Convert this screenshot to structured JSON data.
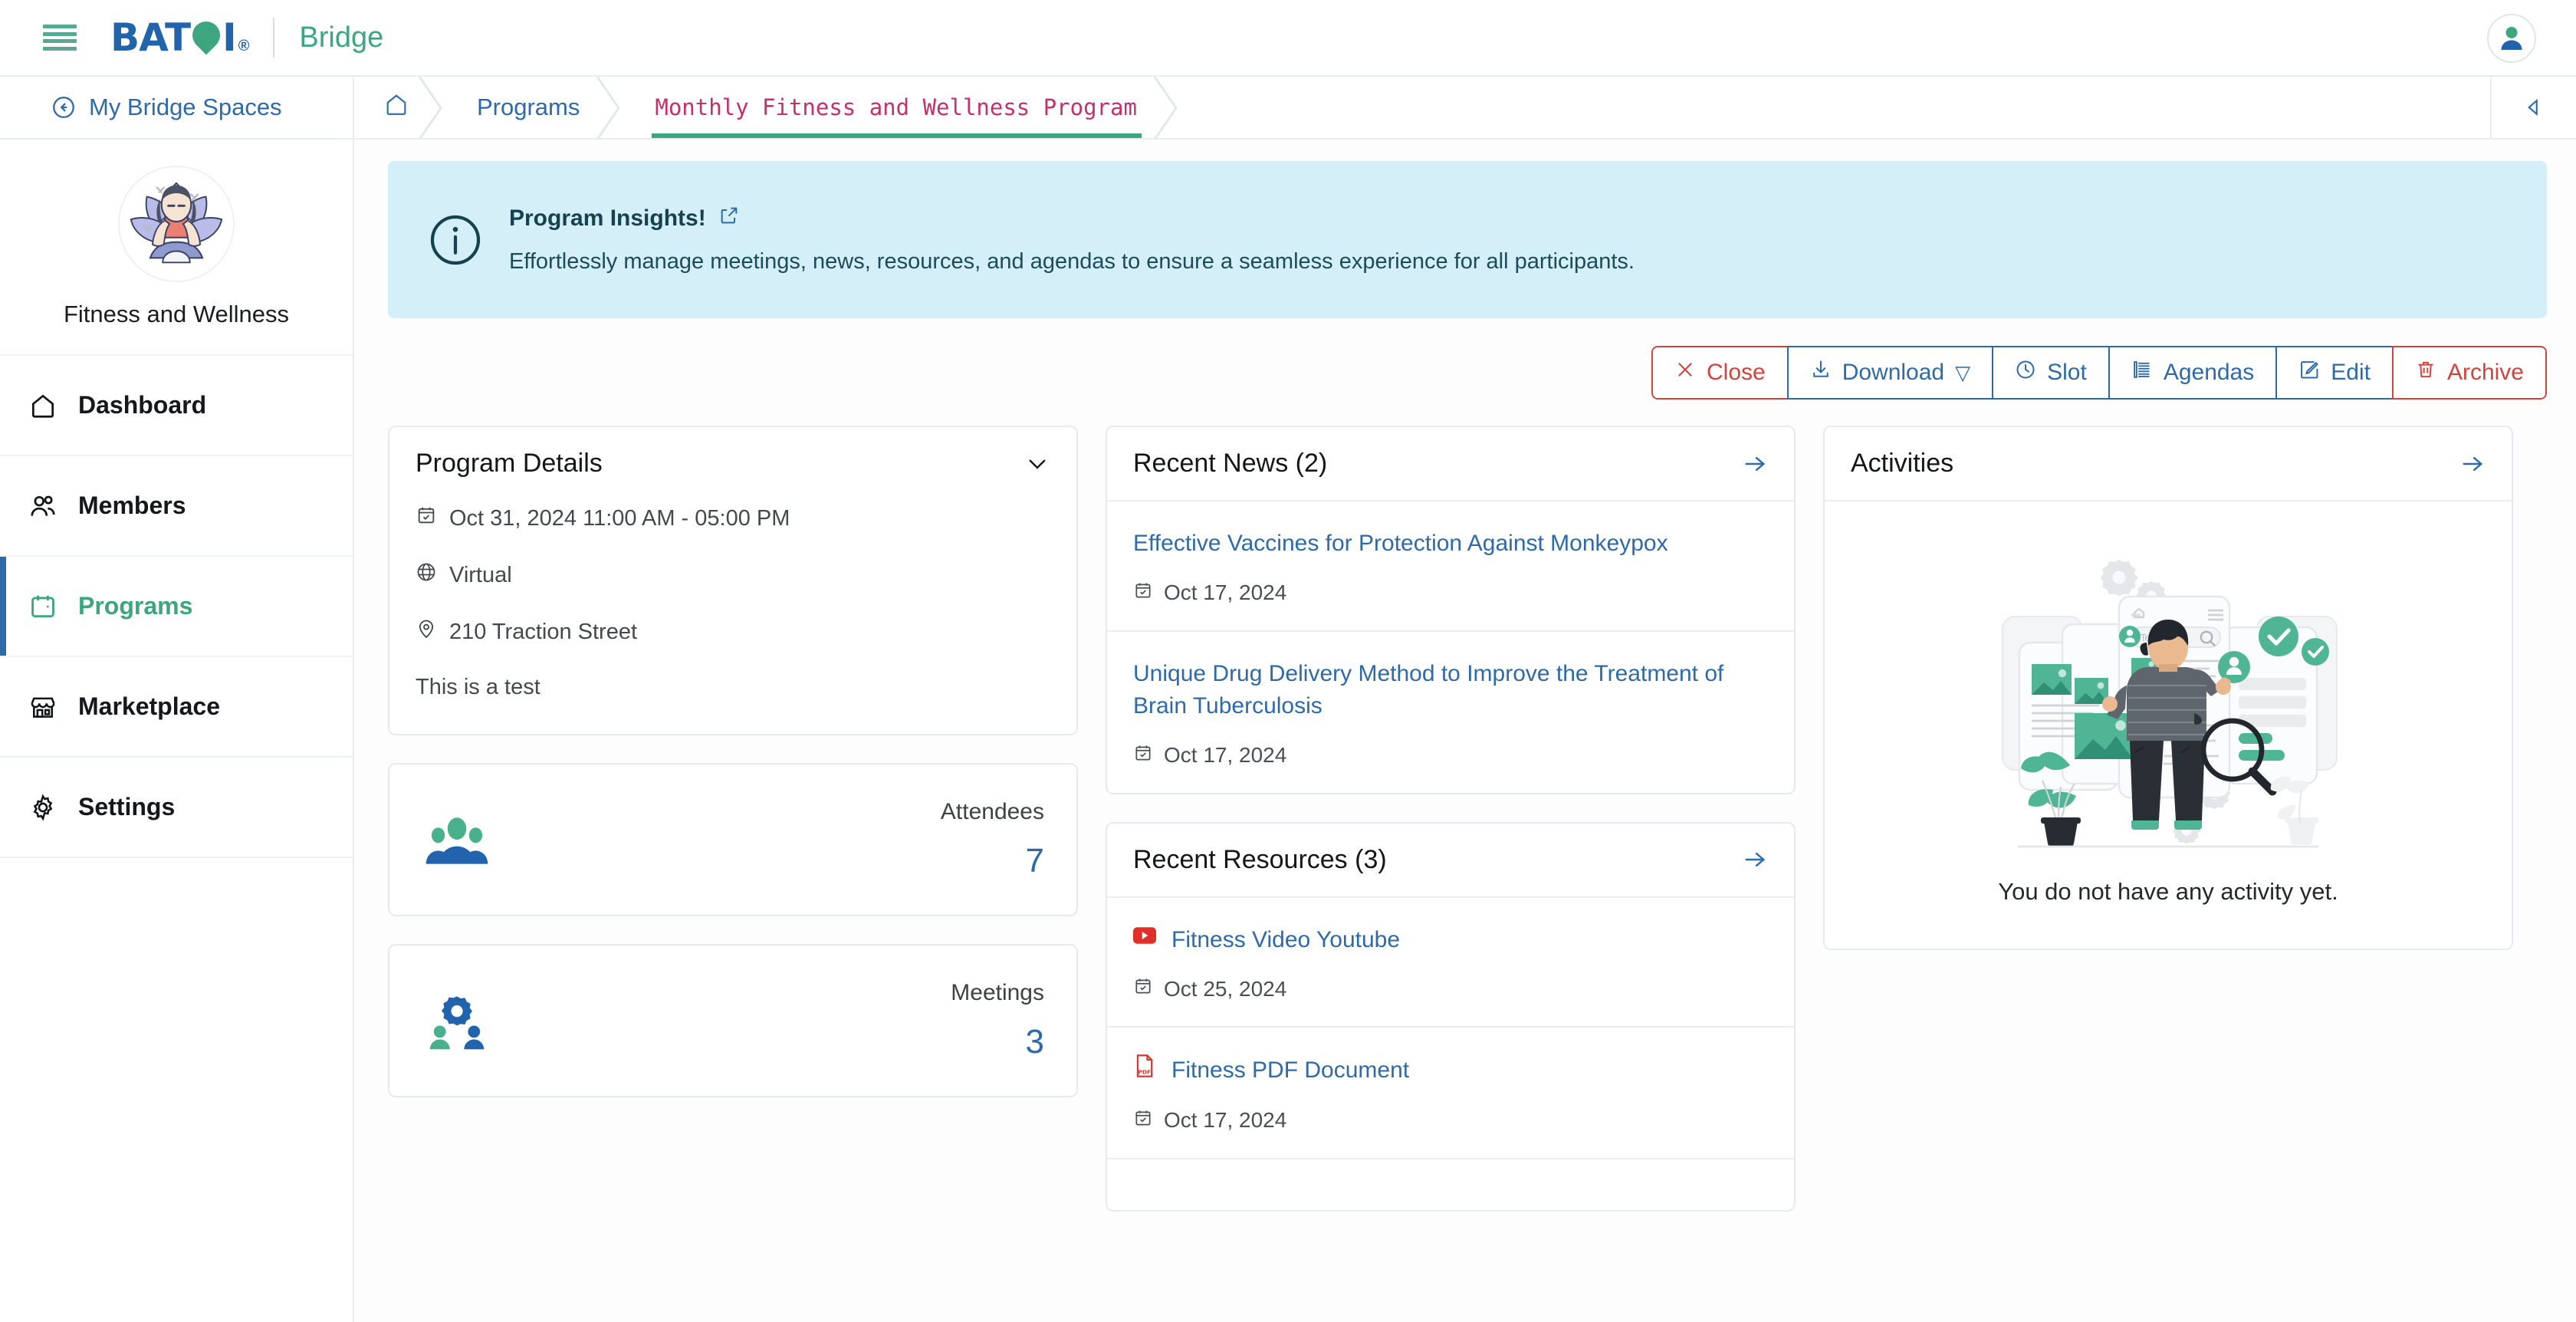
{
  "header": {
    "menu_icon": "hamburger-icon",
    "brand": "BATOI",
    "brand_registered": "®",
    "brand_sub": "Bridge",
    "user_icon": "user-avatar-icon"
  },
  "breadcrumb": {
    "back_label": "My Bridge Spaces",
    "back_icon": "circle-back-arrow-icon",
    "home_icon": "home-icon",
    "items": [
      {
        "label": "Programs",
        "active": false
      },
      {
        "label": "Monthly Fitness and Wellness Program",
        "active": true
      }
    ],
    "collapse_icon": "collapse-left-icon"
  },
  "sidebar": {
    "space_name": "Fitness and Wellness",
    "space_avatar_icon": "yoga-meditation-avatar",
    "items": [
      {
        "label": "Dashboard",
        "icon": "home-icon",
        "active": false
      },
      {
        "label": "Members",
        "icon": "users-icon",
        "active": false
      },
      {
        "label": "Programs",
        "icon": "calendar-icon",
        "active": true
      },
      {
        "label": "Marketplace",
        "icon": "storefront-icon",
        "active": false
      },
      {
        "label": "Settings",
        "icon": "gear-icon",
        "active": false
      }
    ]
  },
  "banner": {
    "icon": "info-circle-icon",
    "title": "Program Insights!",
    "external_icon": "external-link-icon",
    "description": "Effortlessly manage meetings, news, resources, and agendas to ensure a seamless experience for all participants."
  },
  "toolbar": {
    "buttons": [
      {
        "label": "Close",
        "icon": "close-x-icon",
        "style": "danger"
      },
      {
        "label": "Download",
        "icon": "download-icon",
        "style": "primary",
        "caret": "▽"
      },
      {
        "label": "Slot",
        "icon": "clock-icon",
        "style": "primary"
      },
      {
        "label": "Agendas",
        "icon": "list-lines-icon",
        "style": "primary"
      },
      {
        "label": "Edit",
        "icon": "edit-pencil-icon",
        "style": "primary"
      },
      {
        "label": "Archive",
        "icon": "trash-icon",
        "style": "danger"
      }
    ]
  },
  "program_details": {
    "title": "Program Details",
    "chevron_icon": "chevron-down-icon",
    "date": "Oct 31, 2024 11:00 AM - 05:00 PM",
    "date_icon": "calendar-check-icon",
    "mode": "Virtual",
    "mode_icon": "globe-icon",
    "address": "210 Traction Street",
    "address_icon": "map-pin-icon",
    "note": "This is a test"
  },
  "stats": [
    {
      "label": "Attendees",
      "value": "7",
      "icon": "people-group-icon"
    },
    {
      "label": "Meetings",
      "value": "3",
      "icon": "gear-people-icon"
    }
  ],
  "recent_news": {
    "title": "Recent News (2)",
    "arrow_icon": "arrow-right-icon",
    "items": [
      {
        "title": "Effective Vaccines for Protection Against Monkeypox",
        "date": "Oct 17, 2024",
        "date_icon": "calendar-check-icon"
      },
      {
        "title": "Unique Drug Delivery Method to Improve the Treatment of Brain Tuberculosis",
        "date": "Oct 17, 2024",
        "date_icon": "calendar-check-icon"
      }
    ]
  },
  "recent_resources": {
    "title": "Recent Resources (3)",
    "arrow_icon": "arrow-right-icon",
    "items": [
      {
        "title": "Fitness Video Youtube",
        "date": "Oct 25, 2024",
        "icon": "youtube-icon",
        "date_icon": "calendar-check-icon"
      },
      {
        "title": "Fitness PDF Document",
        "date": "Oct 17, 2024",
        "icon": "pdf-file-icon",
        "date_icon": "calendar-check-icon"
      }
    ]
  },
  "activities": {
    "title": "Activities",
    "arrow_icon": "arrow-right-icon",
    "empty_illustration": "person-browsing-screens-illustration",
    "empty_text": "You do not have any activity yet."
  },
  "colors": {
    "brand_blue": "#2164ad",
    "brand_green": "#3da57f",
    "link_blue": "#2e6aa8",
    "danger_red": "#d0443d",
    "crumb_active_pink": "#c2306f",
    "banner_bg": "#d4eff8",
    "border": "#e6e9ee"
  }
}
